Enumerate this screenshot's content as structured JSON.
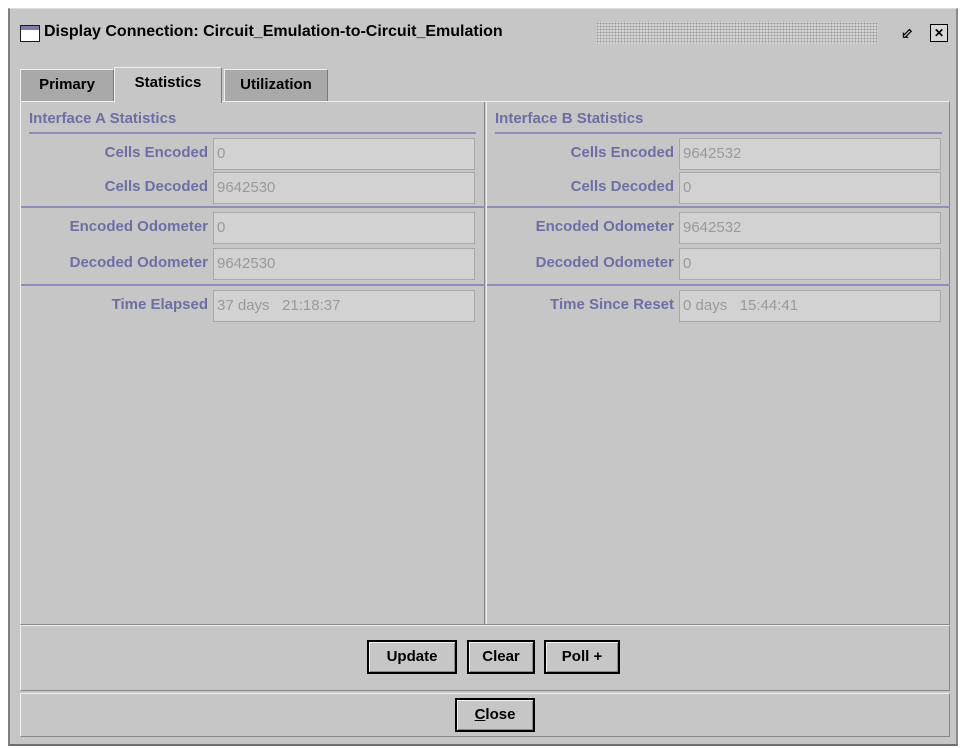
{
  "window": {
    "title": "Display Connection: Circuit_Emulation-to-Circuit_Emulation",
    "restore_glyph": "⬃",
    "close_glyph": "✕"
  },
  "tabs": [
    {
      "label": "Primary",
      "selected": false
    },
    {
      "label": "Statistics",
      "selected": true
    },
    {
      "label": "Utilization",
      "selected": false
    }
  ],
  "interface_a": {
    "title": "Interface A Statistics",
    "rows": [
      {
        "label": "Cells Encoded",
        "value": "0"
      },
      {
        "label": "Cells Decoded",
        "value": "9642530"
      },
      {
        "label": "Encoded Odometer",
        "value": "0"
      },
      {
        "label": "Decoded Odometer",
        "value": "9642530"
      },
      {
        "label": "Time Elapsed",
        "value": "37 days   21:18:37"
      }
    ]
  },
  "interface_b": {
    "title": "Interface B Statistics",
    "rows": [
      {
        "label": "Cells Encoded",
        "value": "9642532"
      },
      {
        "label": "Cells Decoded",
        "value": "0"
      },
      {
        "label": "Encoded Odometer",
        "value": "9642532"
      },
      {
        "label": "Decoded Odometer",
        "value": "0"
      },
      {
        "label": "Time Since Reset",
        "value": "0 days   15:44:41"
      }
    ]
  },
  "actions": {
    "update": "Update",
    "clear": "Clear",
    "poll": "Poll +",
    "close_mnemonic": "C",
    "close_rest": "lose"
  },
  "colors": {
    "background": "#c6c6c6",
    "label_text": "#6e6ea4",
    "field_bg": "#d2d2d2",
    "field_text": "#9a9a9a"
  }
}
